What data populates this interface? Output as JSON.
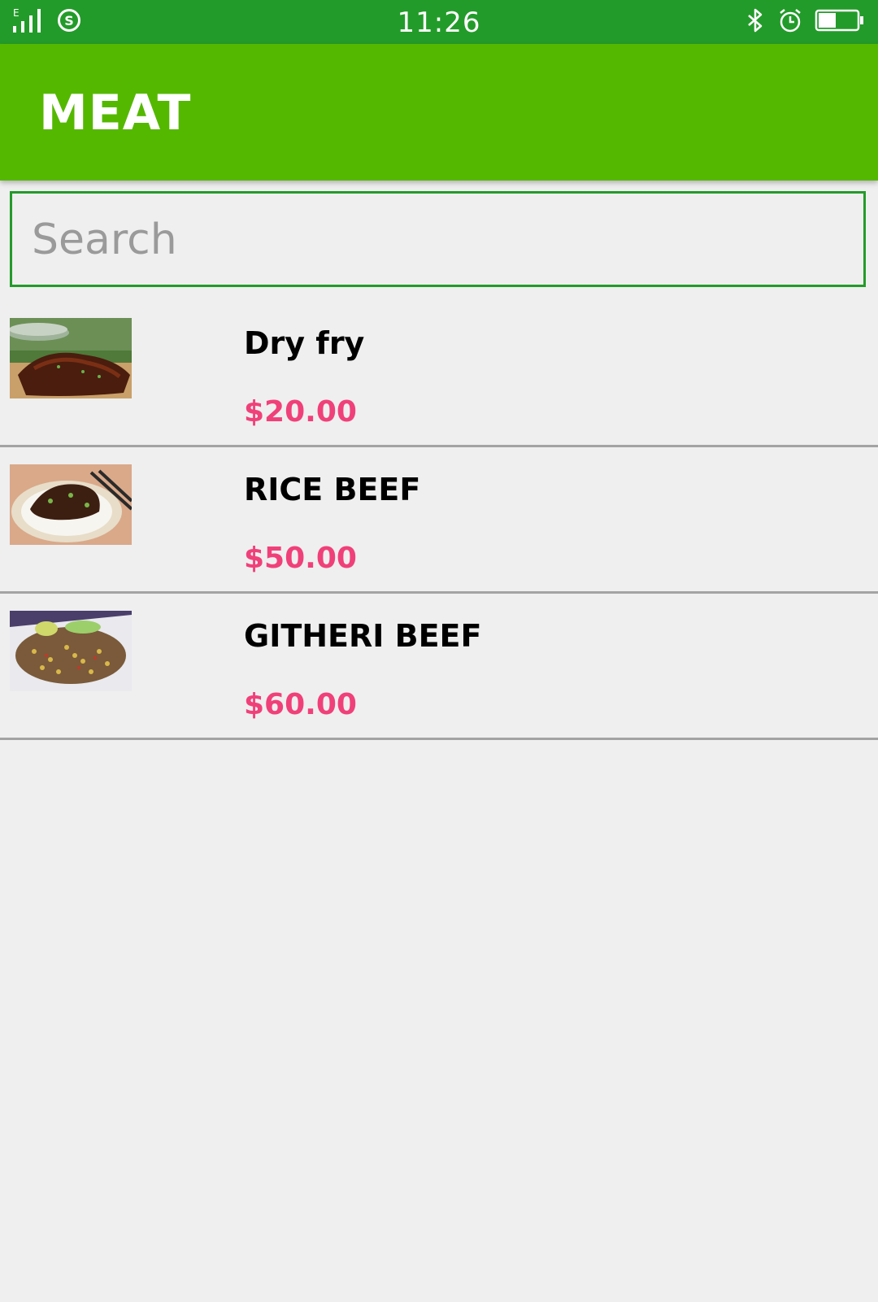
{
  "status_bar": {
    "time": "11:26",
    "network_label": "E",
    "icons": [
      "signal-icon",
      "sync-icon",
      "bluetooth-icon",
      "alarm-icon",
      "battery-icon"
    ],
    "battery_level": 0.45
  },
  "app_bar": {
    "title": "MEAT"
  },
  "search": {
    "placeholder": "Search",
    "value": ""
  },
  "items": [
    {
      "name": "Dry fry",
      "price": "$20.00"
    },
    {
      "name": "RICE BEEF",
      "price": "$50.00"
    },
    {
      "name": "GITHERI BEEF",
      "price": "$60.00"
    }
  ],
  "colors": {
    "status_bar": "#239b2a",
    "app_bar": "#55b800",
    "accent": "#239b2a",
    "price": "#f0407a",
    "background": "#efefef",
    "divider": "#a3a3a3"
  }
}
